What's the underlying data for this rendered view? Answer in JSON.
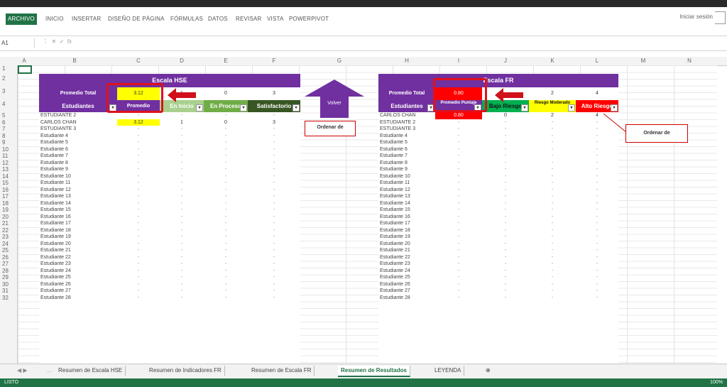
{
  "ribbon": {
    "tabs": [
      "ARCHIVO",
      "INICIO",
      "INSERTAR",
      "DISEÑO DE PÁGINA",
      "FÓRMULAS",
      "DATOS",
      "REVISAR",
      "VISTA",
      "POWERPIVOT"
    ],
    "signin": "Iniciar sesión"
  },
  "formula_bar": {
    "name_box": "A1",
    "fx": "fx"
  },
  "columns": [
    "A",
    "B",
    "C",
    "D",
    "E",
    "F",
    "G",
    "H",
    "I",
    "J",
    "K",
    "L",
    "M",
    "N"
  ],
  "rows": [
    "1",
    "2",
    "3",
    "4",
    "5",
    "6",
    "7",
    "8",
    "9",
    "10",
    "11",
    "12",
    "13",
    "14",
    "15",
    "16",
    "17",
    "18",
    "19",
    "20",
    "21",
    "22",
    "23",
    "24",
    "25",
    "26",
    "27",
    "28",
    "29",
    "30",
    "31",
    "32"
  ],
  "hse": {
    "title": "Escala HSE",
    "promedio_label": "Promedio Total",
    "promedio_value": "3.12",
    "counts": [
      "1",
      "0",
      "3"
    ],
    "headers": [
      "Estudiantes",
      "Promedio",
      "En Inicio",
      "En Proceso",
      "Satisfactorio"
    ],
    "data_rows": [
      [
        "ESTUDIANTE 2",
        "-",
        "-",
        "-",
        "-"
      ],
      [
        "CARLOS CHAN",
        "3.12",
        "1",
        "0",
        "3"
      ],
      [
        "ESTUDIANTE 3",
        "-",
        "-",
        "-",
        "-"
      ],
      [
        "Estudiante 4",
        "-",
        "-",
        "-",
        "-"
      ],
      [
        "Estudiante 5",
        "-",
        "-",
        "-",
        "-"
      ],
      [
        "Estudiante 6",
        "-",
        "-",
        "-",
        "-"
      ],
      [
        "Estudiante 7",
        "-",
        "-",
        "-",
        "-"
      ],
      [
        "Estudiante 8",
        "-",
        "-",
        "-",
        "-"
      ],
      [
        "Estudiante 9",
        "-",
        "-",
        "-",
        "-"
      ],
      [
        "Estudiante 10",
        "-",
        "-",
        "-",
        "-"
      ],
      [
        "Estudiante 11",
        "-",
        "-",
        "-",
        "-"
      ],
      [
        "Estudiante 12",
        "-",
        "-",
        "-",
        "-"
      ],
      [
        "Estudiante 13",
        "-",
        "-",
        "-",
        "-"
      ],
      [
        "Estudiante 14",
        "-",
        "-",
        "-",
        "-"
      ],
      [
        "Estudiante 15",
        "-",
        "-",
        "-",
        "-"
      ],
      [
        "Estudiante 16",
        "-",
        "-",
        "-",
        "-"
      ],
      [
        "Estudiante 17",
        "-",
        "-",
        "-",
        "-"
      ],
      [
        "Estudiante 18",
        "-",
        "-",
        "-",
        "-"
      ],
      [
        "Estudiante 19",
        "-",
        "-",
        "-",
        "-"
      ],
      [
        "Estudiante 20",
        "-",
        "-",
        "-",
        "-"
      ],
      [
        "Estudiante 21",
        "-",
        "-",
        "-",
        "-"
      ],
      [
        "Estudiante 22",
        "-",
        "-",
        "-",
        "-"
      ],
      [
        "Estudiante 23",
        "-",
        "-",
        "-",
        "-"
      ],
      [
        "Estudiante 24",
        "-",
        "-",
        "-",
        "-"
      ],
      [
        "Estudiante 25",
        "-",
        "-",
        "-",
        "-"
      ],
      [
        "Estudiante 26",
        "-",
        "-",
        "-",
        "-"
      ],
      [
        "Estudiante 27",
        "-",
        "-",
        "-",
        "-"
      ],
      [
        "Estudiante 28",
        "-",
        "-",
        "-",
        "-"
      ]
    ]
  },
  "fr": {
    "title": "Escala FR",
    "promedio_label": "Promedio Total",
    "promedio_value": "0.80",
    "counts": [
      "2",
      "4"
    ],
    "headers": [
      "Estudiantes",
      "Promedio Puntaje",
      "Bajo Riesgo",
      "Riesgo Moderado",
      "Alto Riesgo"
    ],
    "first_value": "0.80",
    "data_rows": [
      [
        "CARLOS CHAN",
        "-",
        "0",
        "2",
        "4"
      ],
      [
        "ESTUDIANTE 2",
        "-",
        "-",
        "-",
        "-"
      ],
      [
        "ESTUDIANTE 3",
        "-",
        "-",
        "-",
        "-"
      ],
      [
        "Estudiante 4",
        "-",
        "-",
        "-",
        "-"
      ],
      [
        "Estudiante 5",
        "-",
        "-",
        "-",
        "-"
      ],
      [
        "Estudiante 6",
        "-",
        "-",
        "-",
        "-"
      ],
      [
        "Estudiante 7",
        "-",
        "-",
        "-",
        "-"
      ],
      [
        "Estudiante 8",
        "-",
        "-",
        "-",
        "-"
      ],
      [
        "Estudiante 9",
        "-",
        "-",
        "-",
        "-"
      ],
      [
        "Estudiante 10",
        "-",
        "-",
        "-",
        "-"
      ],
      [
        "Estudiante 11",
        "-",
        "-",
        "-",
        "-"
      ],
      [
        "Estudiante 12",
        "-",
        "-",
        "-",
        "-"
      ],
      [
        "Estudiante 13",
        "-",
        "-",
        "-",
        "-"
      ],
      [
        "Estudiante 14",
        "-",
        "-",
        "-",
        "-"
      ],
      [
        "Estudiante 15",
        "-",
        "-",
        "-",
        "-"
      ],
      [
        "Estudiante 16",
        "-",
        "-",
        "-",
        "-"
      ],
      [
        "Estudiante 17",
        "-",
        "-",
        "-",
        "-"
      ],
      [
        "Estudiante 18",
        "-",
        "-",
        "-",
        "-"
      ],
      [
        "Estudiante 19",
        "-",
        "-",
        "-",
        "-"
      ],
      [
        "Estudiante 20",
        "-",
        "-",
        "-",
        "-"
      ],
      [
        "Estudiante 21",
        "-",
        "-",
        "-",
        "-"
      ],
      [
        "Estudiante 22",
        "-",
        "-",
        "-",
        "-"
      ],
      [
        "Estudiante 23",
        "-",
        "-",
        "-",
        "-"
      ],
      [
        "Estudiante 24",
        "-",
        "-",
        "-",
        "-"
      ],
      [
        "Estudiante 25",
        "-",
        "-",
        "-",
        "-"
      ],
      [
        "Estudiante 26",
        "-",
        "-",
        "-",
        "-"
      ],
      [
        "Estudiante 27",
        "-",
        "-",
        "-",
        "-"
      ],
      [
        "Estudiante 28",
        "-",
        "-",
        "-",
        "-"
      ]
    ]
  },
  "volver_label": "Volver",
  "ordenar_left": "Ordenar de",
  "ordenar_right": "Ordenar de",
  "sheet_tabs": [
    "Resumen de Escala HSE",
    "Resumen de Indicadores FR",
    "Resumen de Escala FR",
    "Resumen de Resultados",
    "LEYENDA"
  ],
  "active_sheet": "Resumen de Resultados",
  "status": {
    "left": "LISTO",
    "zoom": "100%"
  },
  "colors": {
    "purple": "#7030a0",
    "excel_green": "#217346",
    "yellow": "#ffff00",
    "red": "#ff0000",
    "green": "#00b050",
    "light_green": "#a9d08e",
    "dark_green": "#548235"
  }
}
